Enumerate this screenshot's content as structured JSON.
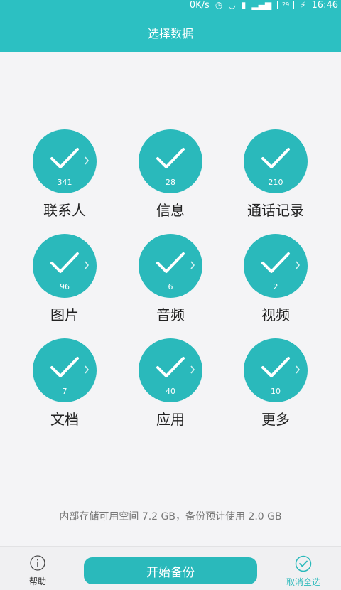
{
  "status_bar": {
    "speed": "0K/s",
    "battery": "29",
    "time": "16:46"
  },
  "header": {
    "title": "选择数据"
  },
  "items": [
    {
      "label": "联系人",
      "count": "341"
    },
    {
      "label": "信息",
      "count": "28"
    },
    {
      "label": "通话记录",
      "count": "210"
    },
    {
      "label": "图片",
      "count": "96"
    },
    {
      "label": "音频",
      "count": "6"
    },
    {
      "label": "视频",
      "count": "2"
    },
    {
      "label": "文档",
      "count": "7"
    },
    {
      "label": "应用",
      "count": "40"
    },
    {
      "label": "更多",
      "count": "10"
    }
  ],
  "storage_text": "内部存储可用空间 7.2 GB，备份预计使用 2.0 GB",
  "bottom_bar": {
    "help_label": "帮助",
    "start_button_label": "开始备份",
    "cancel_all_label": "取消全选"
  },
  "colors": {
    "accent": "#2ab9bb",
    "header": "#2cc0c2"
  },
  "icons": {
    "check": "check-icon",
    "chevron": "chevron-right-icon",
    "help": "info-circle-icon",
    "cancel_all": "check-circle-icon"
  }
}
